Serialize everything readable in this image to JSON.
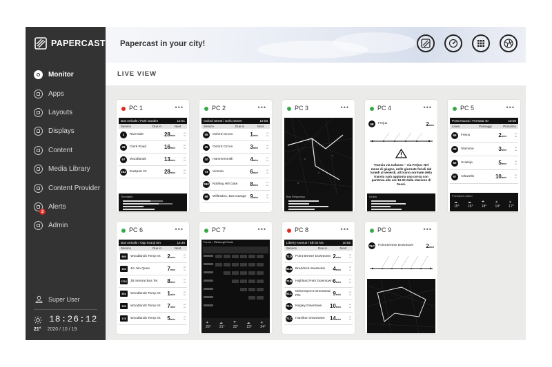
{
  "app": {
    "brand": "PAPERCAST",
    "header_title": "Papercast in your city!",
    "section_title": "LIVE VIEW"
  },
  "sidebar": {
    "items": [
      {
        "label": "Monitor",
        "icon": "monitor-icon",
        "active": true
      },
      {
        "label": "Apps",
        "icon": "apps-icon"
      },
      {
        "label": "Layouts",
        "icon": "layouts-icon"
      },
      {
        "label": "Displays",
        "icon": "displays-icon"
      },
      {
        "label": "Content",
        "icon": "content-icon"
      },
      {
        "label": "Media Library",
        "icon": "media-library-icon"
      },
      {
        "label": "Content Provider",
        "icon": "content-provider-icon"
      },
      {
        "label": "Alerts",
        "icon": "alerts-icon",
        "badge": "2"
      },
      {
        "label": "Admin",
        "icon": "admin-icon"
      }
    ],
    "user": "Super User",
    "time": "18:26:12",
    "temp": "21°",
    "date": "2020 / 10 / 19"
  },
  "header_icons": [
    "papercast-icon",
    "gauge-icon",
    "grid-icon",
    "map-icon"
  ],
  "colors": {
    "sidebar": "#333333",
    "red": "#e0281e",
    "green": "#37a846"
  },
  "cards": [
    {
      "name": "PC 1",
      "status": "red",
      "more": "•••"
    },
    {
      "name": "PC 2",
      "status": "green",
      "more": "•••"
    },
    {
      "name": "PC 3",
      "status": "green",
      "more": "•••"
    },
    {
      "name": "PC 4",
      "status": "green",
      "more": "•••"
    },
    {
      "name": "PC 5",
      "status": "green",
      "more": "•••"
    },
    {
      "name": "PC 6",
      "status": "green",
      "more": "•••"
    },
    {
      "name": "PC 7",
      "status": "green",
      "more": "•••"
    },
    {
      "name": "PC 8",
      "status": "red",
      "more": "•••"
    },
    {
      "name": "PC 9",
      "status": "green",
      "more": "•••"
    }
  ],
  "pc1": {
    "stop": "Bus Arrivals / Park Garden",
    "clock": "12:01",
    "col_service": "Service",
    "col_due": "Due in",
    "col_next": "Next",
    "rows": [
      {
        "route": "2",
        "dest": "Riverside",
        "due": "28",
        "unit": "min"
      },
      {
        "route": "28",
        "dest": "Clark Road",
        "due": "16",
        "unit": "min"
      },
      {
        "route": "67",
        "dest": "Woodlands",
        "due": "13",
        "unit": "min"
      },
      {
        "route": "222",
        "dest": "Eastport Int",
        "due": "28",
        "unit": "min"
      }
    ],
    "freq_title": "Timetable"
  },
  "pc2": {
    "stop": "Oxford Street / Soho Street",
    "clock": "12:03",
    "col_service": "Service",
    "col_due": "Due in",
    "col_next": "Next",
    "rows": [
      {
        "route": "55",
        "dest": "Oxford Circus",
        "due": "1",
        "unit": "min"
      },
      {
        "route": "25",
        "dest": "Oxford Circus",
        "due": "3",
        "unit": "min"
      },
      {
        "route": "10",
        "dest": "Hammersmith",
        "due": "4",
        "unit": "min"
      },
      {
        "route": "73",
        "dest": "Victoria",
        "due": "6",
        "unit": "min"
      },
      {
        "route": "390",
        "dest": "Nothing Hill Gate",
        "due": "8",
        "unit": "min"
      },
      {
        "route": "98",
        "dest": "Willesden, Bus Garage",
        "due": "9",
        "unit": "min"
      }
    ]
  },
  "pc3": {
    "freq_title": "Bus Frequency"
  },
  "pc4": {
    "route": "68",
    "dest": "Frejus",
    "due": "2",
    "unit": "min",
    "notice": "Tranvia via Cafasso – via Frejus: Nel mese di giugno, nelle giornate feriali dal lunedì al venerdì, all'orario normale della tranvia sarà aggiunta una corsa con partenza alle ore 19.00 dalla stazione di Sassi.",
    "foot": "Orario"
  },
  "pc5": {
    "stop": "Porta Nuova / Fermata 40",
    "clock": "18:00",
    "col_line": "Linea",
    "col_pass": "Passaggi",
    "col_next": "Prossimo",
    "rows": [
      {
        "route": "68",
        "dest": "Frejus",
        "due": "2",
        "unit": "min"
      },
      {
        "route": "33",
        "dest": "Stazione",
        "due": "3",
        "unit": "min"
      },
      {
        "route": "52",
        "dest": "Scialoja",
        "due": "5",
        "unit": "min"
      },
      {
        "route": "67",
        "dest": "Arbarello",
        "due": "10",
        "unit": "min"
      }
    ],
    "weather_title": "Previsioni meteo",
    "temps": [
      "15°",
      "16°",
      "18°",
      "19°",
      "17°"
    ]
  },
  "pc6": {
    "stop": "Bus Arrivals / Opp Kranji Stn",
    "clock": "13:45",
    "col_service": "Service",
    "col_due": "Due in",
    "col_next": "Next",
    "rows": [
      {
        "route": "969",
        "dest": "Woodlands Temp Int",
        "due": "2",
        "unit": "min"
      },
      {
        "route": "169",
        "dest": "Jin Jim Quee",
        "due": "7",
        "unit": "min"
      },
      {
        "route": "170X",
        "dest": "JB Sentral Bus Ter",
        "due": "8",
        "unit": "min"
      },
      {
        "route": "961",
        "dest": "Woodlands Temp Int",
        "due": "1",
        "unit": "min"
      },
      {
        "route": "925",
        "dest": "Woodlands Temp Int",
        "due": "7",
        "unit": "min"
      },
      {
        "route": "178",
        "dest": "Woodlands Temp Int",
        "due": "5",
        "unit": "min"
      }
    ]
  },
  "pc7": {
    "title": "Forest – Pittsburgh Route",
    "temps": [
      "20°",
      "21°",
      "22°",
      "23°",
      "24°"
    ]
  },
  "pc8": {
    "stop": "Liberty Avenue / 6th St NS",
    "clock": "10:56",
    "col_service": "Service",
    "col_due": "Due in",
    "col_next": "Next",
    "rows": [
      {
        "route": "71D",
        "dest": "Point Breeze Downtown",
        "due": "2",
        "unit": "min"
      },
      {
        "route": "61B",
        "dest": "Braddock-Swissvale",
        "due": "4",
        "unit": "min"
      },
      {
        "route": "71B",
        "dest": "Highland Park Downtown",
        "due": "6",
        "unit": "min"
      },
      {
        "route": "61C",
        "dest": "Mckeesport Homestead Pitt.",
        "due": "9",
        "unit": "min"
      },
      {
        "route": "71A",
        "dest": "Negley Downtown",
        "due": "10",
        "unit": "min"
      },
      {
        "route": "71C",
        "dest": "Hamilton Downtown",
        "due": "14",
        "unit": "min"
      }
    ]
  },
  "pc9": {
    "route": "71C",
    "dest": "Point Breeze Downtown",
    "due": "2",
    "unit": "min"
  }
}
